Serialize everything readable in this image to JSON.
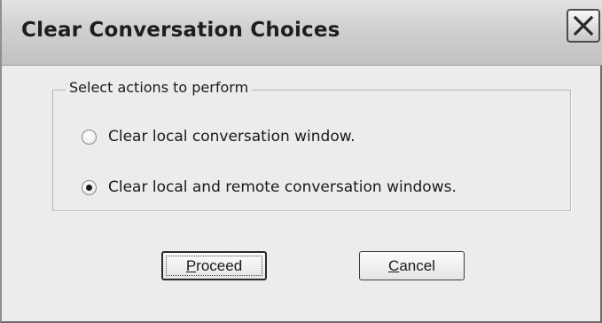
{
  "dialog": {
    "title": "Clear Conversation Choices"
  },
  "group": {
    "legend": "Select actions to perform"
  },
  "options": [
    {
      "label": "Clear local conversation window.",
      "checked": false
    },
    {
      "label": "Clear local and remote conversation windows.",
      "checked": true
    }
  ],
  "buttons": {
    "proceed": {
      "mnemonic": "P",
      "rest": "roceed"
    },
    "cancel": {
      "mnemonic": "C",
      "rest": "ancel"
    }
  },
  "icons": {
    "close": "close-icon"
  }
}
